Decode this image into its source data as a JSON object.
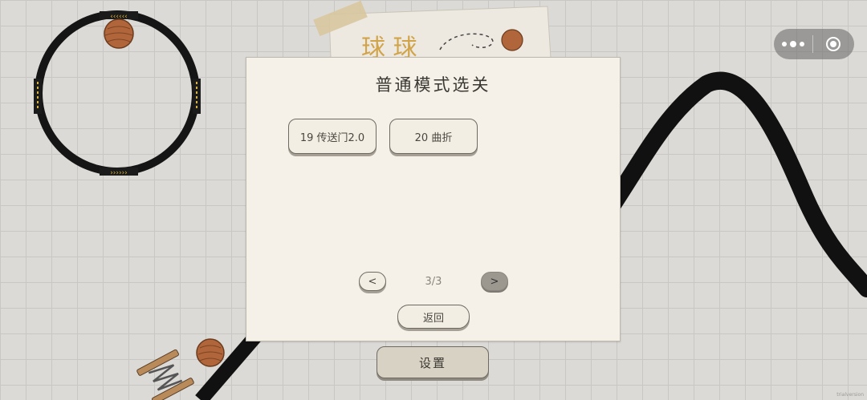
{
  "scene": {
    "title_art_text": "球 球"
  },
  "capsule": {
    "menu_icon": "more-dots-icon",
    "close_icon": "target-circle-icon"
  },
  "modal": {
    "title": "普通模式选关",
    "levels": [
      {
        "label": "19 传送门2.0"
      },
      {
        "label": "20 曲折"
      }
    ],
    "pagination": {
      "prev_label": "<",
      "next_label": ">",
      "page_text": "3/3"
    },
    "back_label": "返回"
  },
  "settings_label": "设置",
  "watermark_text": "trialversion",
  "colors": {
    "track": "#111111",
    "ball": "#b0653a",
    "panel_bg": "#f5f1e8",
    "accent_yellow": "#d6b23a"
  }
}
